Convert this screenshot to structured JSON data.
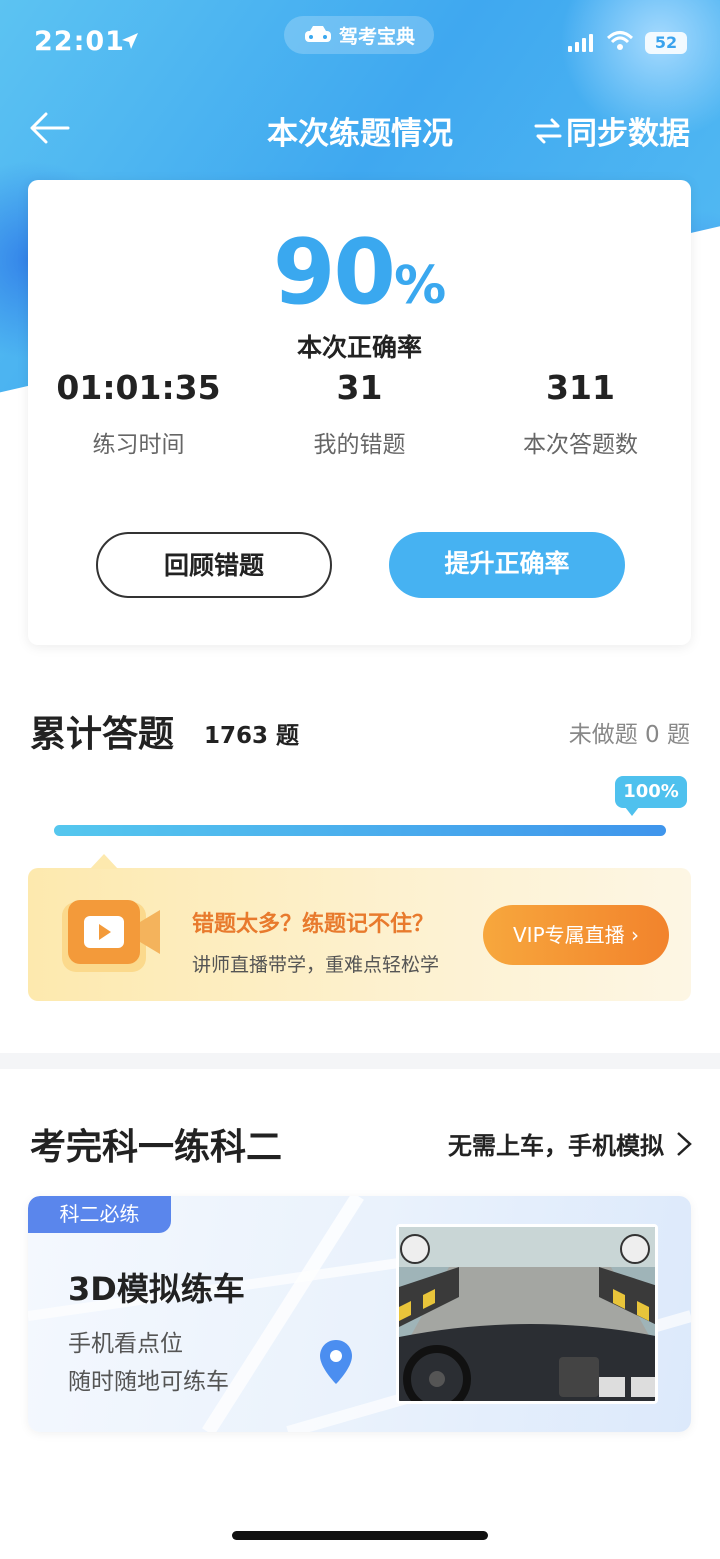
{
  "status_bar": {
    "time": "22:01",
    "app_pill": "驾考宝典",
    "battery": "52"
  },
  "nav": {
    "title": "本次练题情况",
    "sync": "同步数据",
    "sync_icon": "swap-arrows-icon"
  },
  "summary": {
    "rate_value": "90",
    "rate_unit": "%",
    "rate_label": "本次正确率",
    "stats": [
      {
        "value": "01:01:35",
        "label": "练习时间"
      },
      {
        "value": "31",
        "label": "我的错题"
      },
      {
        "value": "311",
        "label": "本次答题数"
      }
    ],
    "review_button": "回顾错题",
    "improve_button": "提升正确率"
  },
  "cumulative": {
    "title": "累计答题",
    "count": "1763 题",
    "undone": "未做题 0 题",
    "progress_label": "100%",
    "progress": 1.0
  },
  "promo": {
    "headline": "错题太多？练题记不住？",
    "subline": "讲师直播带学，重难点轻松学",
    "vip_button": "VIP专属直播"
  },
  "kemu2": {
    "title": "考完科一练科二",
    "link": "无需上车，手机模拟",
    "tag": "科二必练",
    "card_title": "3D模拟练车",
    "line1": "手机看点位",
    "line2": "随时随地可练车"
  },
  "colors": {
    "accent": "#3aa8ef",
    "promo_orange": "#e87a2d",
    "tag_blue": "#5a86ec"
  }
}
